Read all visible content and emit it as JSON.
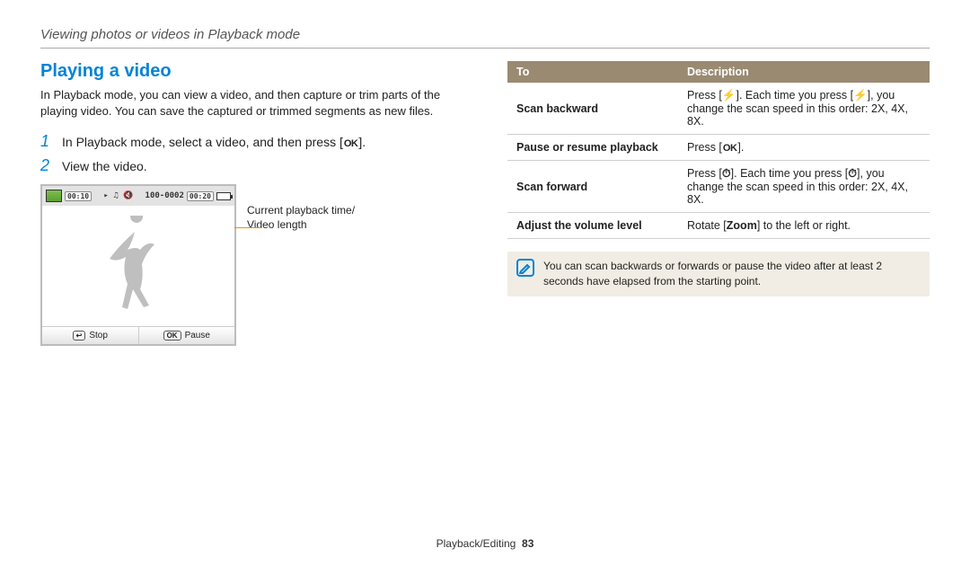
{
  "header": "Viewing photos or videos in Playback mode",
  "title": "Playing a video",
  "intro": "In Playback mode, you can view a video, and then capture or trim parts of the playing video. You can save the captured or trimmed segments as new files.",
  "steps": {
    "s1_num": "1",
    "s1_pre": "In Playback mode, select a video, and then press [",
    "s1_post": "].",
    "s2_num": "2",
    "s2_text": "View the video."
  },
  "preview": {
    "time_cur": "00:10",
    "counter": "100-0002",
    "time_total": "00:20",
    "stop_label": "Stop",
    "pause_label": "Pause"
  },
  "callout": "Current playback time/\nVideo length",
  "table": {
    "head_to": "To",
    "head_desc": "Description",
    "r1_to": "Scan backward",
    "r1_pre": "Press [",
    "r1_mid": "]. Each time you press [",
    "r1_post": "], you change the scan speed in this order: 2X, 4X, 8X.",
    "r2_to": "Pause or resume playback",
    "r2_pre": "Press [",
    "r2_post": "].",
    "r3_to": "Scan forward",
    "r3_pre": "Press [",
    "r3_mid": "]. Each time you press [",
    "r3_post": "], you change the scan speed in this order: 2X, 4X, 8X.",
    "r4_to": "Adjust the volume level",
    "r4_pre": "Rotate [",
    "r4_bold": "Zoom",
    "r4_post": "] to the left or right."
  },
  "note": "You can scan backwards or forwards or pause the video after at least 2 seconds have elapsed from the starting point.",
  "footer_section": "Playback/Editing",
  "footer_page": "83",
  "icons": {
    "ok": "OK",
    "flash": "⚡",
    "timer": "⏱",
    "back": "↩",
    "note": "✎"
  }
}
